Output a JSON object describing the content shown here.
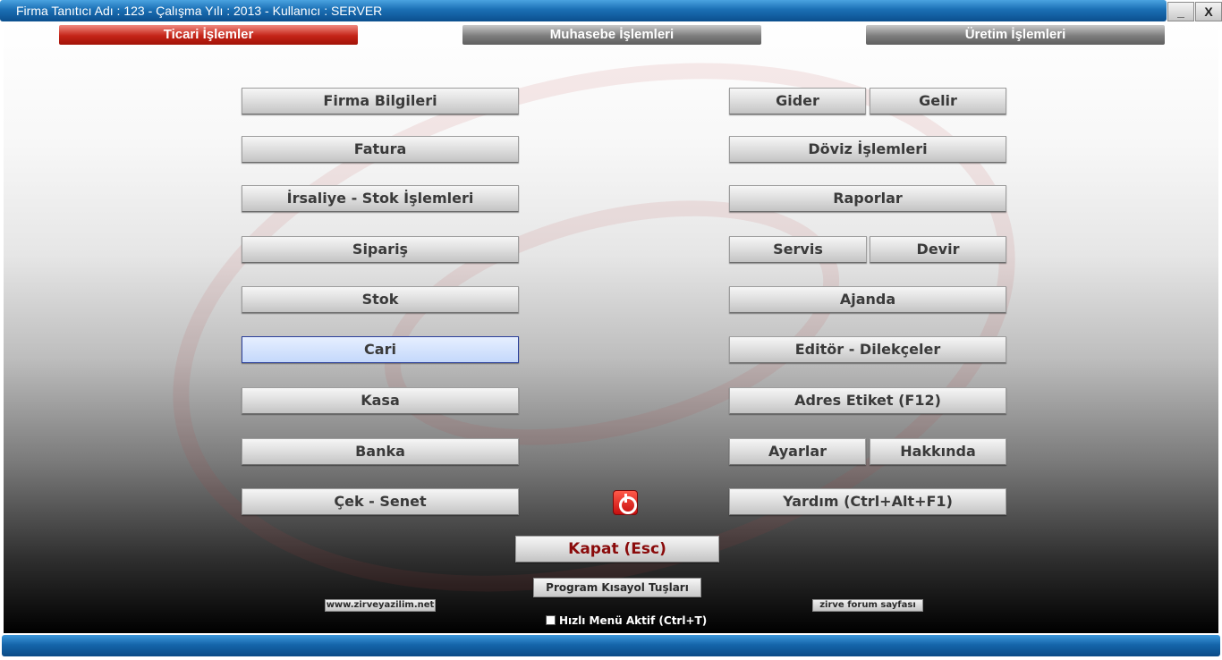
{
  "window": {
    "title": "Firma Tanıtıcı Adı : 123 - Çalışma Yılı : 2013 - Kullanıcı : SERVER",
    "minimize_label": "_",
    "close_label": "X"
  },
  "tabs": [
    {
      "label": "Ticari İşlemler",
      "active": true
    },
    {
      "label": "Muhasebe İşlemleri",
      "active": false
    },
    {
      "label": "Üretim İşlemleri",
      "active": false
    }
  ],
  "left_menu": [
    "Firma Bilgileri",
    "Fatura",
    "İrsaliye - Stok İşlemleri",
    "Sipariş",
    "Stok",
    "Cari",
    "Kasa",
    "Banka",
    "Çek - Senet"
  ],
  "right_menu": {
    "gider": "Gider",
    "gelir": "Gelir",
    "doviz": "Döviz İşlemleri",
    "raporlar": "Raporlar",
    "servis": "Servis",
    "devir": "Devir",
    "ajanda": "Ajanda",
    "editor": "Editör - Dilekçeler",
    "adres_etiket": "Adres Etiket (F12)",
    "ayarlar": "Ayarlar",
    "hakkinda": "Hakkında",
    "yardim": "Yardım (Ctrl+Alt+F1)"
  },
  "bottom": {
    "kapat": "Kapat (Esc)",
    "kisayol": "Program Kısayol Tuşları",
    "website": "www.zirveyazilim.net",
    "forum": "zirve forum sayfası",
    "hizli_menu": "Hızlı Menü Aktif (Ctrl+T)",
    "hizli_menu_checked": false
  },
  "colors": {
    "titlebar": "#1b6fb4",
    "active_tab": "#c42418",
    "inactive_tab": "#7d7d7d",
    "focus_border": "#2b3f9a",
    "kapat_text": "#8a0b0b"
  },
  "icons": {
    "power": "power-icon"
  }
}
